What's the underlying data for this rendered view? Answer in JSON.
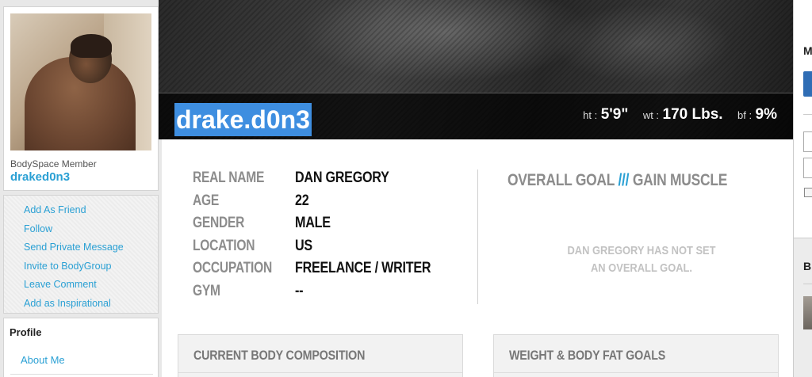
{
  "sidebar": {
    "member_label": "BodySpace Member",
    "member_name": "draked0n3",
    "actions": [
      "Add As Friend",
      "Follow",
      "Send Private Message",
      "Invite to BodyGroup",
      "Leave Comment",
      "Add as Inspirational"
    ],
    "profile_title": "Profile",
    "profile_link": "About Me"
  },
  "banner": {
    "username": "drake.d0n3",
    "stats": [
      {
        "label": "ht :",
        "value": "5'9\""
      },
      {
        "label": "wt :",
        "value": "170 Lbs."
      },
      {
        "label": "bf :",
        "value": "9%"
      }
    ]
  },
  "info": {
    "rows": [
      {
        "label": "REAL NAME",
        "value": "DAN GREGORY"
      },
      {
        "label": "AGE",
        "value": "22"
      },
      {
        "label": "GENDER",
        "value": "MALE"
      },
      {
        "label": "LOCATION",
        "value": "US"
      },
      {
        "label": "OCCUPATION",
        "value": "FREELANCE / WRITER"
      },
      {
        "label": "GYM",
        "value": "--"
      }
    ]
  },
  "goal": {
    "title_left": "OVERALL GOAL",
    "slashes": "///",
    "title_right": "GAIN MUSCLE",
    "message_line1": "DAN GREGORY HAS NOT SET",
    "message_line2": "AN OVERALL GOAL."
  },
  "panels": {
    "left_title": "CURRENT BODY COMPOSITION",
    "right_title": "WEIGHT & BODY FAT GOALS"
  },
  "right_sidebar": {
    "letter_top": "M",
    "letter_bottom": "B"
  },
  "colors": {
    "link": "#2aa0d4",
    "highlight": "#3e8ee0",
    "banner": "#1a1a1a"
  }
}
